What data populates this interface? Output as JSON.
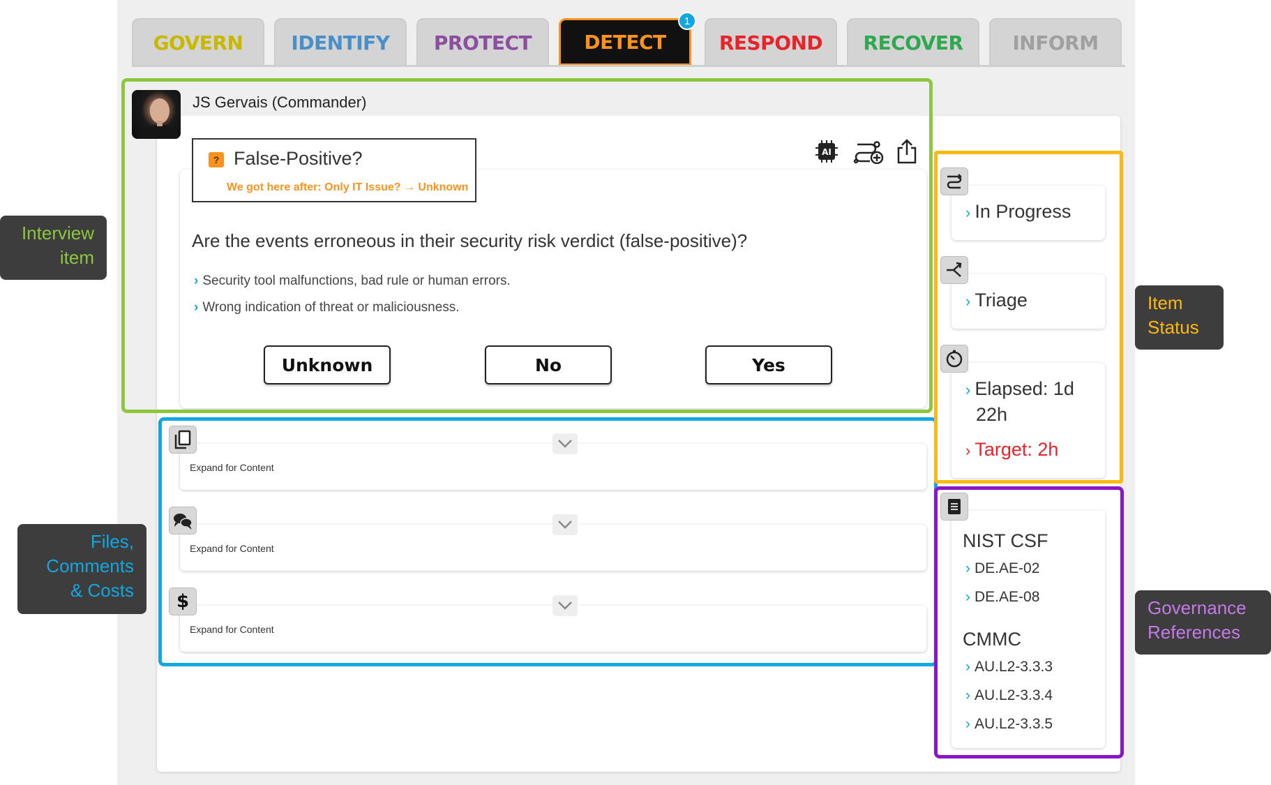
{
  "tabs": [
    {
      "label": "GOVERN",
      "color": "#c8b800"
    },
    {
      "label": "IDENTIFY",
      "color": "#4a90c8"
    },
    {
      "label": "PROTECT",
      "color": "#8a4f9e"
    },
    {
      "label": "DETECT",
      "color": "#f7931e",
      "active": true,
      "badge": "1"
    },
    {
      "label": "RESPOND",
      "color": "#e8242b"
    },
    {
      "label": "RECOVER",
      "color": "#2fa84f"
    },
    {
      "label": "INFORM",
      "color": "#a0a0a0"
    }
  ],
  "user": {
    "name": "JS Gervais (Commander)"
  },
  "interview": {
    "title": "False-Positive?",
    "path": "We got here after: Only IT Issue? → Unknown",
    "question": "Are the events erroneous in their security risk verdict (false-positive)?",
    "bullets": [
      "Security tool malfunctions, bad rule or human errors.",
      "Wrong indication of threat or maliciousness."
    ],
    "answers": [
      "Unknown",
      "No",
      "Yes"
    ],
    "card_icons": [
      "ai-chip-icon",
      "workflow-add-icon",
      "share-icon"
    ]
  },
  "expandables": [
    {
      "icon": "files-icon",
      "label": "Expand for Content"
    },
    {
      "icon": "comments-icon",
      "label": "Expand for Content"
    },
    {
      "icon": "dollar-icon",
      "label": "Expand for Content"
    }
  ],
  "status": {
    "state": "In Progress",
    "phase": "Triage",
    "elapsed_line1": "Elapsed: 1d",
    "elapsed_line2": "22h",
    "target": "Target: 2h"
  },
  "references": {
    "groups": [
      {
        "name": "NIST CSF",
        "items": [
          "DE.AE-02",
          "DE.AE-08"
        ]
      },
      {
        "name": "CMMC",
        "items": [
          "AU.L2-3.3.3",
          "AU.L2-3.3.4",
          "AU.L2-3.3.5"
        ]
      }
    ]
  },
  "callouts": {
    "interview": [
      "Interview",
      "item"
    ],
    "files": [
      "Files,",
      "Comments",
      "& Costs"
    ],
    "status": [
      "Item",
      "Status"
    ],
    "governance": [
      "Governance",
      "References"
    ]
  },
  "colors": {
    "interview_frame": "#8dc63f",
    "files_frame": "#12a7e0",
    "status_frame": "#fbb915",
    "governance_frame": "#8b16c7",
    "target_red": "#e8242b"
  }
}
